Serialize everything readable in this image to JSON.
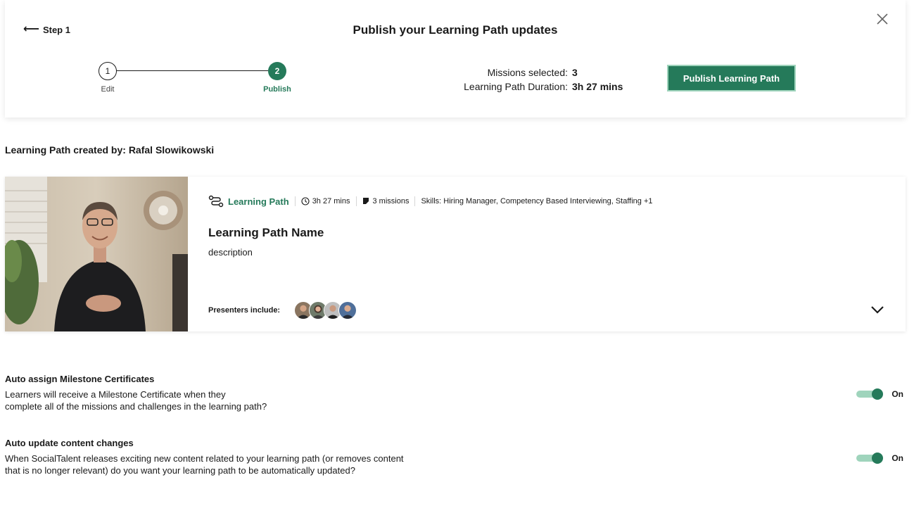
{
  "header": {
    "back_label": "Step 1",
    "title": "Publish your Learning Path updates"
  },
  "stepper": {
    "steps": [
      {
        "number": "1",
        "label": "Edit"
      },
      {
        "number": "2",
        "label": "Publish"
      }
    ]
  },
  "summary": {
    "missions_label": "Missions selected:",
    "missions_value": "3",
    "duration_label": "Learning Path Duration:",
    "duration_value": "3h 27 mins"
  },
  "publish_button_label": "Publish Learning Path",
  "created_by": "Learning Path created by: Rafal Slowikowski",
  "learning_path": {
    "type_label": "Learning Path",
    "duration": "3h 27 mins",
    "missions": "3 missions",
    "skills": "Skills: Hiring Manager, Competency Based Interviewing, Staffing +1",
    "name": "Learning Path Name",
    "description": "description",
    "presenters_label": "Presenters include:"
  },
  "settings": [
    {
      "title": "Auto assign Milestone Certificates",
      "description": "Learners will receive a Milestone Certificate when they\ncomplete all of the missions and challenges in the learning path?",
      "state": "On"
    },
    {
      "title": "Auto update content changes",
      "description": "When SocialTalent releases exciting new content related to your learning path (or removes content\nthat is no longer relevant) do you want your learning path to be automatically updated?",
      "state": "On"
    }
  ],
  "colors": {
    "accent": "#257a5a",
    "accent_light": "#9fd4bc"
  }
}
